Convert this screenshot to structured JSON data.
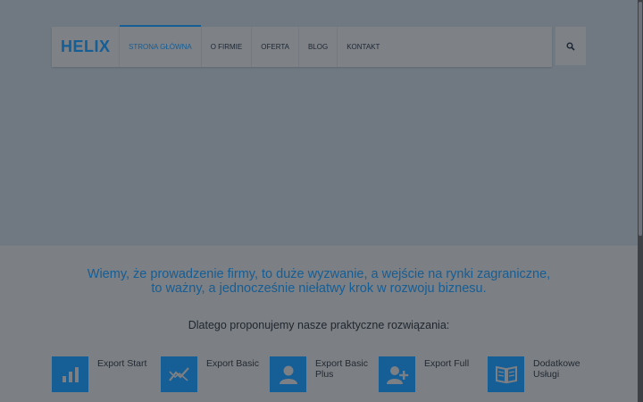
{
  "header": {
    "logo": "HELIX",
    "nav": [
      {
        "label": "STRONA GŁÓWNA"
      },
      {
        "label": "O FIRMIE"
      },
      {
        "label": "OFERTA"
      },
      {
        "label": "BLOG"
      },
      {
        "label": "KONTAKT"
      }
    ],
    "search_icon": "search-icon"
  },
  "intro": {
    "headline_line1": "Wiemy, że prowadzenie firmy, to duże wyzwanie, a wejście na rynki zagraniczne,",
    "headline_line2": "to ważny, a jednocześnie niełatwy krok w rozwoju biznesu.",
    "subline": "Dlatego proponujemy nasze praktyczne rozwiązania:"
  },
  "services": [
    {
      "label": "Export Start",
      "icon": "bar-chart-icon"
    },
    {
      "label": "Export Basic",
      "icon": "line-chart-icon"
    },
    {
      "label": "Export Basic Plus",
      "icon": "user-icon"
    },
    {
      "label": "Export Full",
      "icon": "user-plus-icon"
    },
    {
      "label": "Dodatkowe Usługi",
      "icon": "book-icon"
    }
  ],
  "colors": {
    "accent": "#155e96",
    "overlay_dim": "#6f7780"
  }
}
